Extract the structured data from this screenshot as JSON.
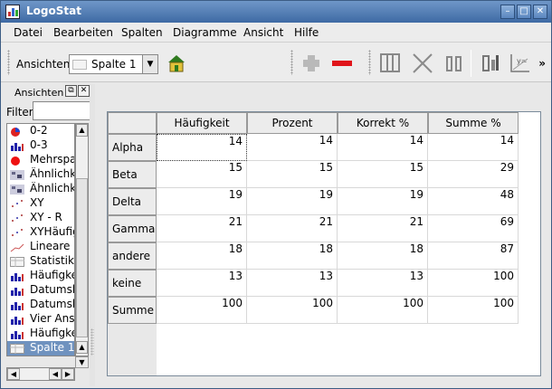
{
  "window": {
    "title": "LogoStat"
  },
  "menu": [
    "Datei",
    "Bearbeiten",
    "Spalten",
    "Diagramme",
    "Ansicht",
    "Hilfe"
  ],
  "toolbar": {
    "ansichten_label": "Ansichten",
    "combo_value": "Spalte 1",
    "more": "»"
  },
  "dock": {
    "title": "Ansichten",
    "filter_label": "Filter",
    "filter_value": "",
    "items": [
      {
        "label": "0-2",
        "icon": "pie-chart-icon"
      },
      {
        "label": "0-3",
        "icon": "bar-chart-icon"
      },
      {
        "label": "Mehrspa",
        "icon": "red-dot-icon"
      },
      {
        "label": "Ähnlichk",
        "icon": "matrix-icon"
      },
      {
        "label": "Ähnlichk",
        "icon": "matrix-icon"
      },
      {
        "label": "XY",
        "icon": "xy-plot-icon"
      },
      {
        "label": "XY - R",
        "icon": "xy-plot-icon"
      },
      {
        "label": "XYHäufig",
        "icon": "xy-plot-icon"
      },
      {
        "label": "Lineare F",
        "icon": "line-plot-icon"
      },
      {
        "label": "Statistikta",
        "icon": "table-icon"
      },
      {
        "label": "Häufigke",
        "icon": "bar-chart-icon"
      },
      {
        "label": "Datumsh",
        "icon": "bar-chart-icon"
      },
      {
        "label": "Datumsh",
        "icon": "bar-chart-icon"
      },
      {
        "label": "Vier Ans",
        "icon": "bar-chart-icon"
      },
      {
        "label": "Häufigke",
        "icon": "bar-chart-icon"
      },
      {
        "label": "Spalte 1",
        "icon": "table-icon",
        "selected": true
      }
    ]
  },
  "table": {
    "columns": [
      "Häufigkeit",
      "Prozent",
      "Korrekt %",
      "Summe %"
    ],
    "rows": [
      {
        "label": "Alpha",
        "values": [
          "14",
          "14",
          "14",
          "14"
        ]
      },
      {
        "label": "Beta",
        "values": [
          "15",
          "15",
          "15",
          "29"
        ]
      },
      {
        "label": "Delta",
        "values": [
          "19",
          "19",
          "19",
          "48"
        ]
      },
      {
        "label": "Gamma",
        "values": [
          "21",
          "21",
          "21",
          "69"
        ]
      },
      {
        "label": "andere",
        "values": [
          "18",
          "18",
          "18",
          "87"
        ]
      },
      {
        "label": "keine",
        "values": [
          "13",
          "13",
          "13",
          "100"
        ]
      },
      {
        "label": "Summe",
        "values": [
          "100",
          "100",
          "100",
          "100"
        ]
      }
    ]
  }
}
